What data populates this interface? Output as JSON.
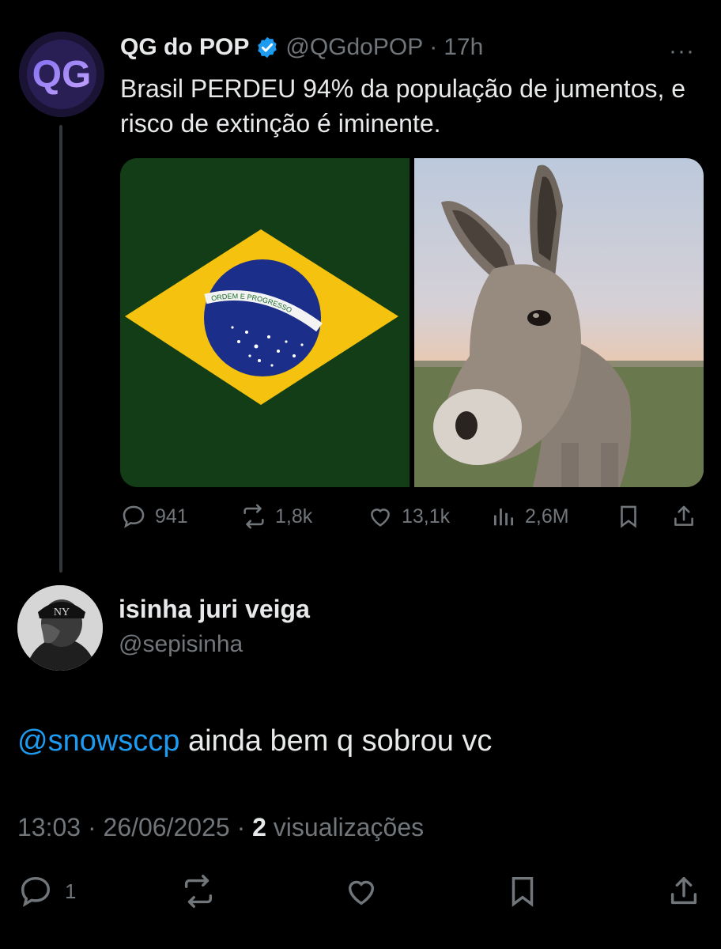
{
  "tweet": {
    "display_name": "QG do POP",
    "handle": "@QGdoPOP",
    "separator": "·",
    "time": "17h",
    "more": "···",
    "avatar_text": "QG",
    "text": "Brasil PERDEU 94% da população de jumentos, e risco de extinção é iminente.",
    "flag_motto": "ORDEM E PROGRESSO",
    "stats": {
      "replies": "941",
      "reposts": "1,8k",
      "likes": "13,1k",
      "views": "2,6M"
    }
  },
  "reply": {
    "display_name": "isinha juri veiga",
    "handle": "@sepisinha",
    "mention": "@snowsccp",
    "text": " ainda bem q sobrou vc",
    "time": "13:03",
    "separator": "·",
    "date": "26/06/2025",
    "views_count": "2",
    "views_label": "visualizações",
    "reply_count": "1"
  },
  "colors": {
    "background": "#000000",
    "text": "#e7e9ea",
    "muted": "#71767b",
    "accent": "#1d9bf0",
    "verified": "#1d9bf0"
  }
}
